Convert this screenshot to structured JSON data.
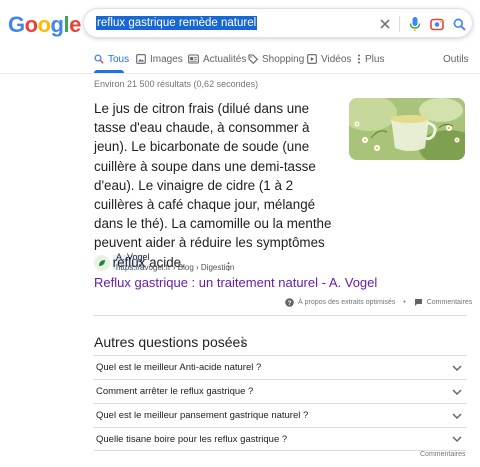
{
  "header": {
    "logo_letters": [
      "G",
      "o",
      "o",
      "g",
      "l",
      "e"
    ],
    "logo_colors": [
      "#4285f4",
      "#ea4335",
      "#fbbc05",
      "#4285f4",
      "#34a853",
      "#ea4335"
    ],
    "search_query": "reflux gastrique remède naturel",
    "icons": [
      "clear-icon",
      "microphone-icon",
      "camera-lens-icon",
      "search-icon"
    ]
  },
  "tabs": [
    {
      "label": "Tous",
      "icon": "search-icon",
      "active": true
    },
    {
      "label": "Images",
      "icon": "image-icon",
      "active": false
    },
    {
      "label": "Actualités",
      "icon": "news-icon",
      "active": false
    },
    {
      "label": "Shopping",
      "icon": "tag-icon",
      "active": false
    },
    {
      "label": "Vidéos",
      "icon": "play-icon",
      "active": false
    },
    {
      "label": "Plus",
      "icon": "more-vert-icon",
      "active": false
    }
  ],
  "tools_label": "Outils",
  "stats": "Environ 21 500 résultats (0,62 secondes)",
  "snippet": {
    "text_before": "Le jus de citron frais (dilué dans une tasse d'eau chaude, à consommer à jeun). Le bicarbonate de soude (une cuillère à soupe dans une demi-tasse d'eau). Le vinaigre de cidre (1 à 2 cuillères à café chaque jour, mélangé dans le thé). La camomille ou la menthe peuvent aider à réduire les symptômes de ",
    "text_highlight": "reflux",
    "text_after": " acide.",
    "image": "chamomile-tea-image"
  },
  "source": {
    "name": "A. Vogel",
    "url": "https://avogel.fr › Blog › Digestion",
    "link_title": "Reflux gastrique : un traitement naturel - A. Vogel"
  },
  "feedback": {
    "about_label": "À propos des extraits optimisés",
    "separator": "•",
    "comments_label": "Commentaires"
  },
  "paa": {
    "title": "Autres questions posées",
    "questions": [
      "Quel est le meilleur Anti-acide naturel ?",
      "Comment arrêter le reflux gastrique ?",
      "Quel est le meilleur pansement gastrique naturel ?",
      "Quelle tisane boire pour les reflux gastrique ?"
    ],
    "footer": "Commentaires"
  },
  "colors": {
    "link_visited": "#681da8",
    "tab_active": "#1a73e8",
    "query_highlight": "#1967d2"
  }
}
